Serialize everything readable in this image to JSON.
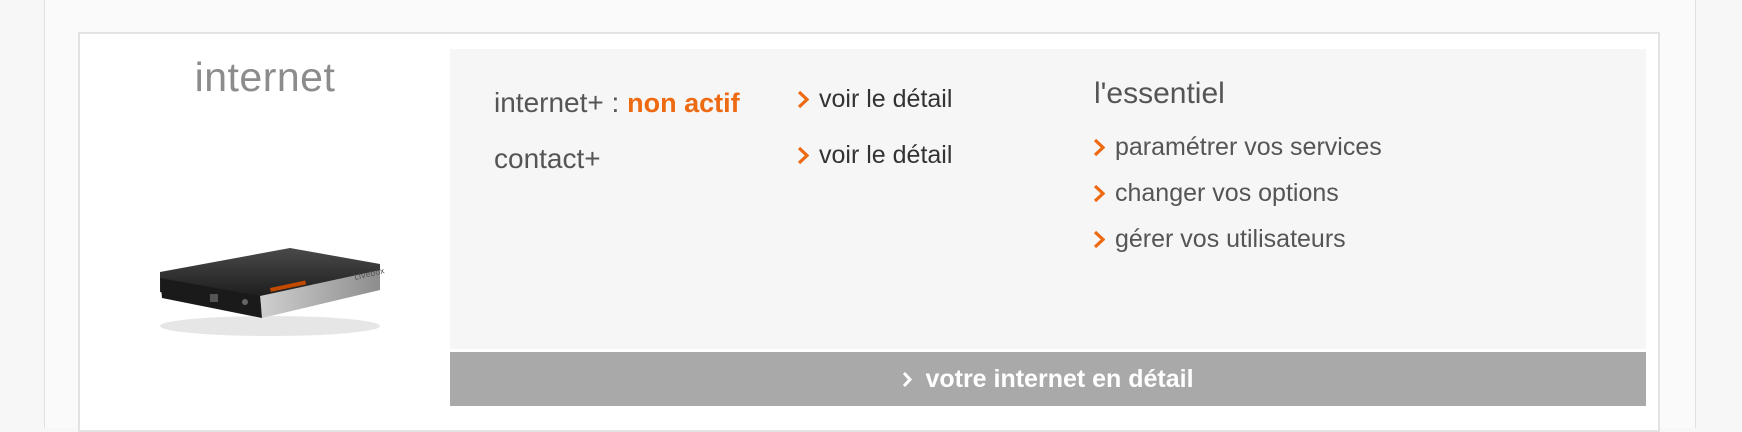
{
  "section": {
    "title": "internet"
  },
  "status": [
    {
      "label": "internet+ :",
      "value": "non actif",
      "detail_link": "voir le détail"
    },
    {
      "label": "contact+",
      "value": "",
      "detail_link": "voir le détail"
    }
  ],
  "essentiel": {
    "title": "l'essentiel",
    "links": [
      "paramétrer vos services",
      "changer vos options",
      "gérer vos utilisateurs"
    ]
  },
  "footer": {
    "link": "votre internet en détail"
  },
  "colors": {
    "accent": "#ee6a12",
    "bar": "#a9a9a9",
    "box_bg": "#f6f6f6"
  },
  "icons": {
    "router": "internet-box-router-icon",
    "chevron": "chevron-right-icon"
  }
}
